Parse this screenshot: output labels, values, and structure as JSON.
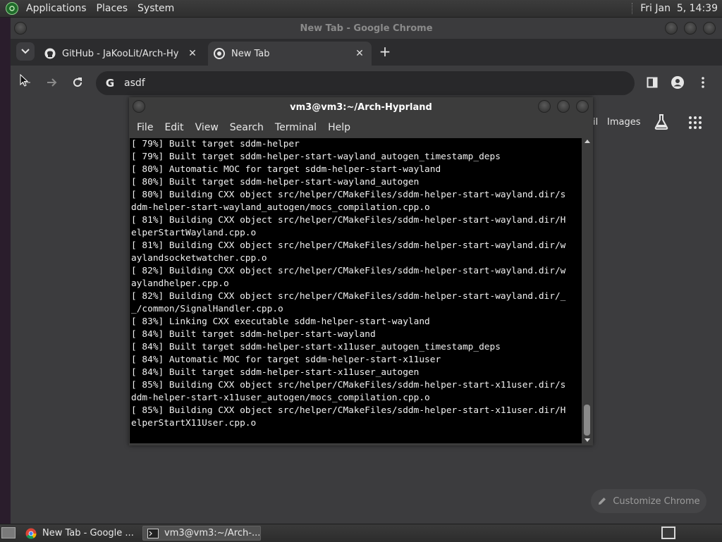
{
  "top_panel": {
    "menus": [
      "Applications",
      "Places",
      "System"
    ],
    "clock": "Fri Jan  5, 14:39"
  },
  "chrome": {
    "window_title": "New Tab - Google Chrome",
    "tabs": [
      {
        "title": "GitHub - JaKooLit/Arch-Hyprl",
        "icon": "github-icon",
        "active": false
      },
      {
        "title": "New Tab",
        "icon": "chrome-icon",
        "active": true
      }
    ],
    "omnibox_text": "asdf",
    "ntp": {
      "link_partial": "il",
      "images_label": "Images",
      "customize_label": "Customize Chrome"
    }
  },
  "terminal": {
    "title": "vm3@vm3:~/Arch-Hyprland",
    "menus": [
      "File",
      "Edit",
      "View",
      "Search",
      "Terminal",
      "Help"
    ],
    "lines": [
      "[ 79%] Built target sddm-helper",
      "[ 79%] Built target sddm-helper-start-wayland_autogen_timestamp_deps",
      "[ 80%] Automatic MOC for target sddm-helper-start-wayland",
      "[ 80%] Built target sddm-helper-start-wayland_autogen",
      "[ 80%] Building CXX object src/helper/CMakeFiles/sddm-helper-start-wayland.dir/s",
      "ddm-helper-start-wayland_autogen/mocs_compilation.cpp.o",
      "[ 81%] Building CXX object src/helper/CMakeFiles/sddm-helper-start-wayland.dir/H",
      "elperStartWayland.cpp.o",
      "[ 81%] Building CXX object src/helper/CMakeFiles/sddm-helper-start-wayland.dir/w",
      "aylandsocketwatcher.cpp.o",
      "[ 82%] Building CXX object src/helper/CMakeFiles/sddm-helper-start-wayland.dir/w",
      "aylandhelper.cpp.o",
      "[ 82%] Building CXX object src/helper/CMakeFiles/sddm-helper-start-wayland.dir/_",
      "_/common/SignalHandler.cpp.o",
      "[ 83%] Linking CXX executable sddm-helper-start-wayland",
      "[ 84%] Built target sddm-helper-start-wayland",
      "[ 84%] Built target sddm-helper-start-x11user_autogen_timestamp_deps",
      "[ 84%] Automatic MOC for target sddm-helper-start-x11user",
      "[ 84%] Built target sddm-helper-start-x11user_autogen",
      "[ 85%] Building CXX object src/helper/CMakeFiles/sddm-helper-start-x11user.dir/s",
      "ddm-helper-start-x11user_autogen/mocs_compilation.cpp.o",
      "[ 85%] Building CXX object src/helper/CMakeFiles/sddm-helper-start-x11user.dir/H",
      "elperStartX11User.cpp.o"
    ]
  },
  "taskbar": {
    "items": [
      {
        "label": "New Tab - Google ...",
        "icon": "chrome-icon",
        "active": false
      },
      {
        "label": "vm3@vm3:~/Arch-...",
        "icon": "terminal-icon",
        "active": true
      }
    ]
  }
}
